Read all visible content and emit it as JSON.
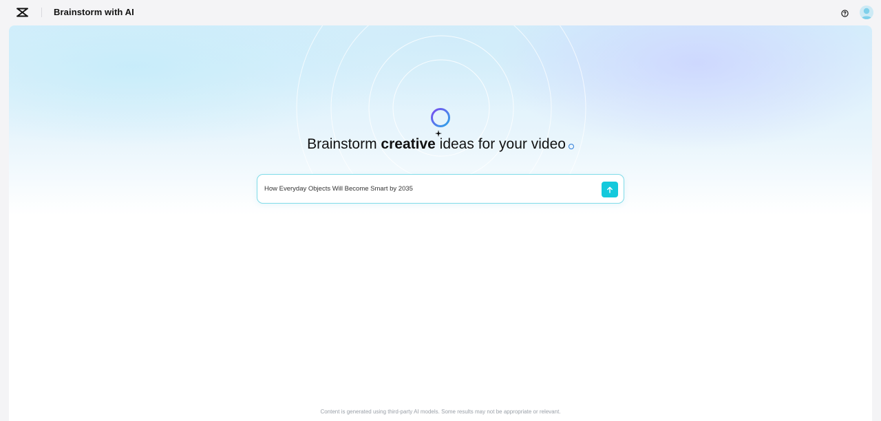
{
  "header": {
    "app_title": "Brainstorm with AI",
    "logo_icon": "capcut-logo-icon",
    "help_icon": "help-circle-icon",
    "avatar_icon": "user-avatar-icon"
  },
  "hero": {
    "icon": "loading-ring-icon",
    "headline_before": "Brainstorm ",
    "headline_bold": "creative",
    "headline_after": " ideas for your video"
  },
  "prompt": {
    "value": "How Everyday Objects Will Become Smart by 2035",
    "send_icon": "arrow-up-icon"
  },
  "footer": {
    "disclaimer": "Content is generated using third-party AI models. Some results may not be appropriate or relevant."
  },
  "colors": {
    "accent": "#14c9dc",
    "border": "#7fdbe8",
    "ring_start": "#7a4cf0",
    "ring_end": "#2ea6e8"
  }
}
